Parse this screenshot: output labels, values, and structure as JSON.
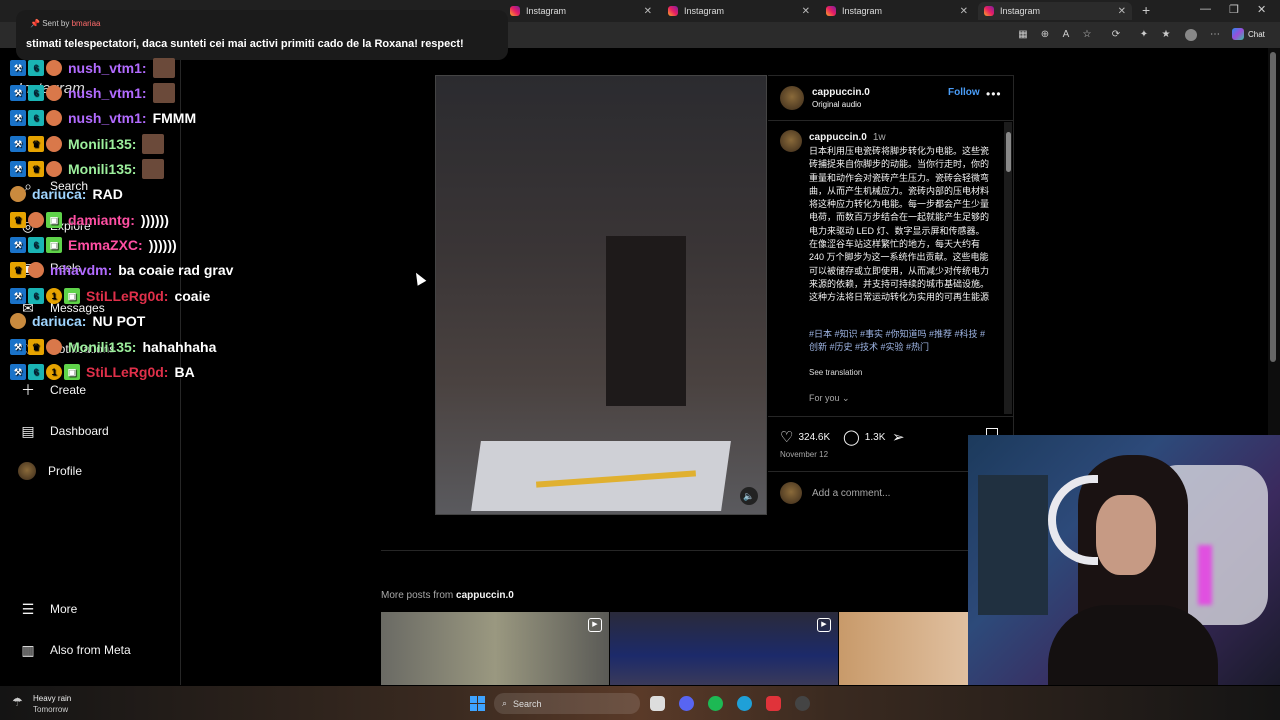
{
  "browser": {
    "tabs": [
      "Instagram",
      "Instagram",
      "Instagram",
      "Instagram"
    ],
    "chat_label": "Chat"
  },
  "sidebar": {
    "logo": "Instagram",
    "items": [
      {
        "label": "Search",
        "icon": "search-icon"
      },
      {
        "label": "Explore",
        "icon": "compass-icon"
      },
      {
        "label": "Reels",
        "icon": "reels-icon"
      },
      {
        "label": "Messages",
        "icon": "messenger-icon"
      },
      {
        "label": "Notifications",
        "icon": "heart-icon"
      },
      {
        "label": "Create",
        "icon": "plus-icon"
      },
      {
        "label": "Dashboard",
        "icon": "dashboard-icon"
      },
      {
        "label": "Profile",
        "icon": "avatar"
      },
      {
        "label": "More",
        "icon": "menu-icon"
      },
      {
        "label": "Also from Meta",
        "icon": "meta-icon"
      }
    ]
  },
  "donation": {
    "sent_by_prefix": "Sent by",
    "sender": "bmariaa",
    "message": "stimati telespectatori, daca sunteti cei mai activi primiti cado de la Roxana! respect!"
  },
  "chat": {
    "lines": [
      {
        "user": "nush_vtm1:",
        "text": "",
        "color": "#b26bff"
      },
      {
        "user": "nush_vtm1:",
        "text": "",
        "color": "#b26bff"
      },
      {
        "user": "nush_vtm1:",
        "text": "FMMM",
        "color": "#b26bff"
      },
      {
        "user": "Monili135:",
        "text": "",
        "color": "#9df09d"
      },
      {
        "user": "Monili135:",
        "text": "",
        "color": "#9df09d"
      },
      {
        "user": "dariuca:",
        "text": "RAD",
        "color": "#9fd5ff"
      },
      {
        "user": "damiantg:",
        "text": "))))))",
        "color": "#ff4fa3"
      },
      {
        "user": "EmmaZXC:",
        "text": "))))))",
        "color": "#ff4fa3"
      },
      {
        "user": "mhavdm:",
        "text": "ba coaie rad grav",
        "color": "#b26bff"
      },
      {
        "user": "StiLLeRg0d:",
        "text": "coaie",
        "color": "#e0304a"
      },
      {
        "user": "dariuca:",
        "text": "NU POT",
        "color": "#9fd5ff"
      },
      {
        "user": "Monili135:",
        "text": "hahahhaha",
        "color": "#9df09d"
      },
      {
        "user": "StiLLeRg0d:",
        "text": "BA",
        "color": "#e0304a"
      }
    ]
  },
  "post": {
    "username": "cappuccin.0",
    "audio": "Original audio",
    "follow": "Follow",
    "time": "1w",
    "caption": "日本利用压电瓷砖将脚步转化为电能。这些瓷砖捕捉来自你脚步的动能。当你行走时，你的重量和动作会对瓷砖产生压力。瓷砖会轻微弯曲，从而产生机械应力。瓷砖内部的压电材料将这种应力转化为电能。每一步都会产生少量电荷，而数百万步结合在一起就能产生足够的电力来驱动 LED 灯、数字显示屏和传感器。在像涩谷车站这样繁忙的地方，每天大约有 240 万个脚步为这一系统作出贡献。这些电能可以被储存或立即使用，从而减少对传统电力来源的依赖，并支持可持续的城市基础设施。这种方法将日常运动转化为实用的可再生能源",
    "hashtags": "#日本 #知识 #事实 #你知道吗 #推荐 #科技 #创新 #历史 #技术 #实验 #热门",
    "see_translation": "See translation",
    "for_you": "For you",
    "likes": "324.6K",
    "comments": "1.3K",
    "date": "November 12",
    "add_comment": "Add a comment..."
  },
  "more_posts": {
    "prefix": "More posts from",
    "user": "cappuccin.0"
  },
  "taskbar": {
    "weather_title": "Heavy rain",
    "weather_sub": "Tomorrow",
    "search": "Search"
  }
}
